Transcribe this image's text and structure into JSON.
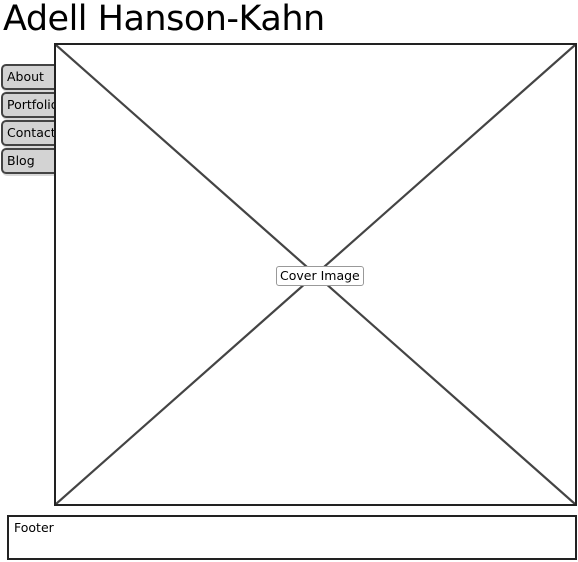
{
  "site": {
    "title": "Adell Hanson-Kahn"
  },
  "nav": {
    "items": [
      {
        "label": "About"
      },
      {
        "label": "Portfolio"
      },
      {
        "label": "Contact"
      },
      {
        "label": "Blog"
      }
    ]
  },
  "main": {
    "cover_label": "Cover Image"
  },
  "footer": {
    "label": "Footer"
  },
  "colors": {
    "tab_fill": "#d3d3d3",
    "border": "#222222"
  }
}
